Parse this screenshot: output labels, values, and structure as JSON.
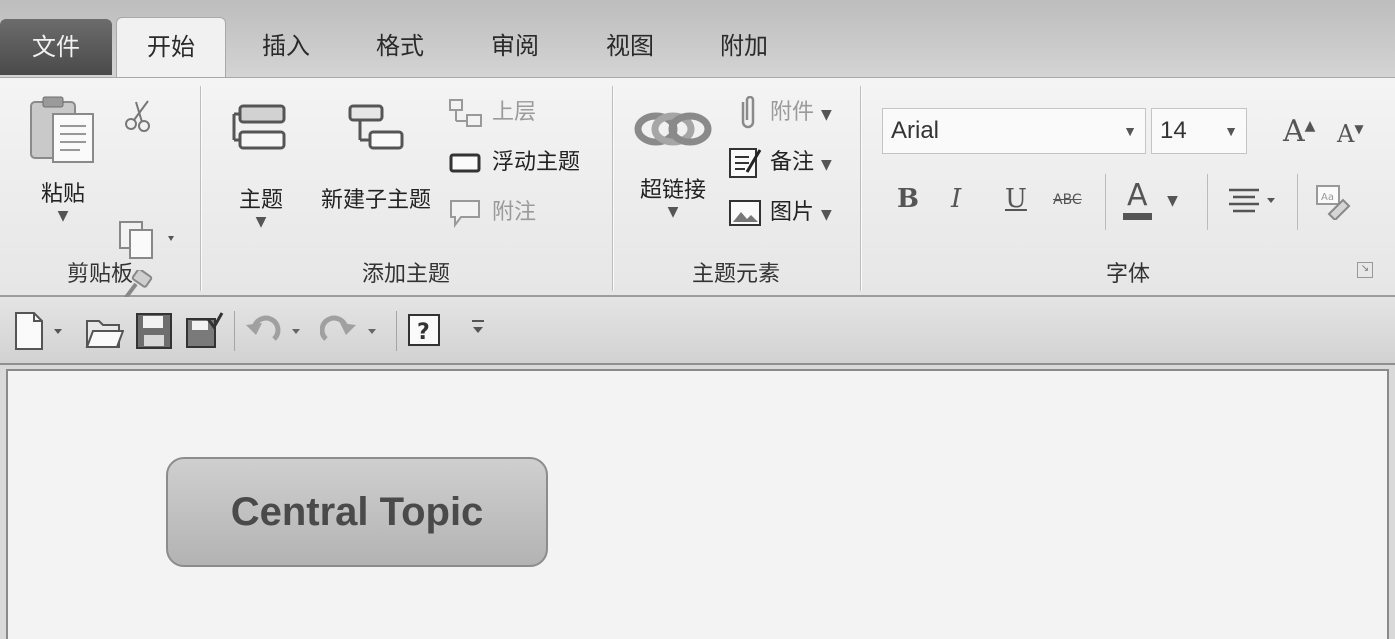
{
  "tabs": {
    "file": "文件",
    "home": "开始",
    "insert": "插入",
    "format": "格式",
    "review": "审阅",
    "view": "视图",
    "addins": "附加"
  },
  "clipboard": {
    "paste": "粘贴",
    "label": "剪贴板"
  },
  "add_topic": {
    "topic": "主题",
    "subtopic": "新建子主题",
    "parent": "上层",
    "floating": "浮动主题",
    "callout": "附注",
    "label": "添加主题"
  },
  "topic_elements": {
    "hyperlink": "超链接",
    "attachment": "附件",
    "notes": "备注",
    "image": "图片",
    "label": "主题元素"
  },
  "font": {
    "family": "Arial",
    "size": "14",
    "label": "字体",
    "bold": "B",
    "italic": "I",
    "underline": "U",
    "strike": "ABC",
    "color_glyph": "A",
    "grow": "A",
    "shrink": "A"
  },
  "canvas": {
    "central_topic": "Central Topic"
  }
}
